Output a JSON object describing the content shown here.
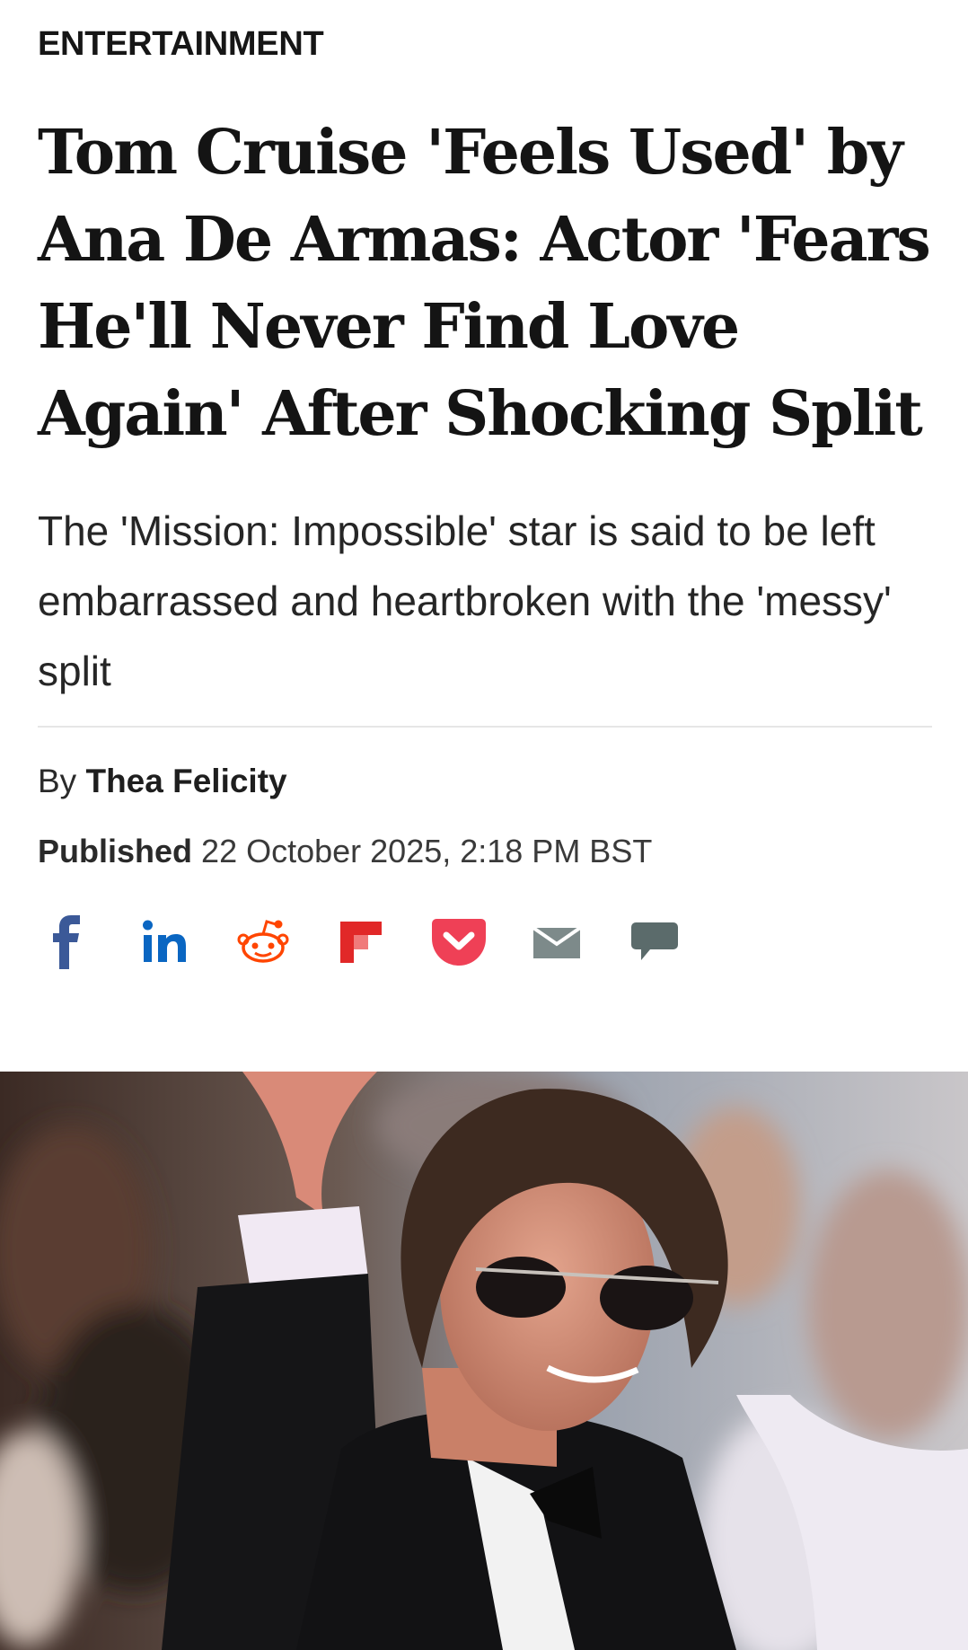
{
  "category": "ENTERTAINMENT",
  "headline": "Tom Cruise 'Feels Used' by Ana De Armas: Actor 'Fears He'll Never Find Love Again' After Shocking Split",
  "standfirst": "The 'Mission: Impossible' star is said to be left embarrassed and heartbroken with the 'messy' split",
  "byline": {
    "prefix": "By",
    "author": "Thea Felicity"
  },
  "published": {
    "label": "Published",
    "datetime": "22 October 2025, 2:18 PM BST"
  },
  "share": {
    "buttons": [
      {
        "icon": "facebook-icon",
        "color": "#3b5998"
      },
      {
        "icon": "linkedin-icon",
        "color": "#0a66c2"
      },
      {
        "icon": "reddit-icon",
        "color": "#ff4500"
      },
      {
        "icon": "flipboard-icon",
        "color": "#e12828"
      },
      {
        "icon": "pocket-icon",
        "color": "#ef4056"
      },
      {
        "icon": "email-icon",
        "color": "#7d8a8a"
      },
      {
        "icon": "comment-icon",
        "color": "#5b6b6b"
      }
    ]
  },
  "colors": {
    "text": "#141414",
    "divider": "#e6e6e6"
  }
}
